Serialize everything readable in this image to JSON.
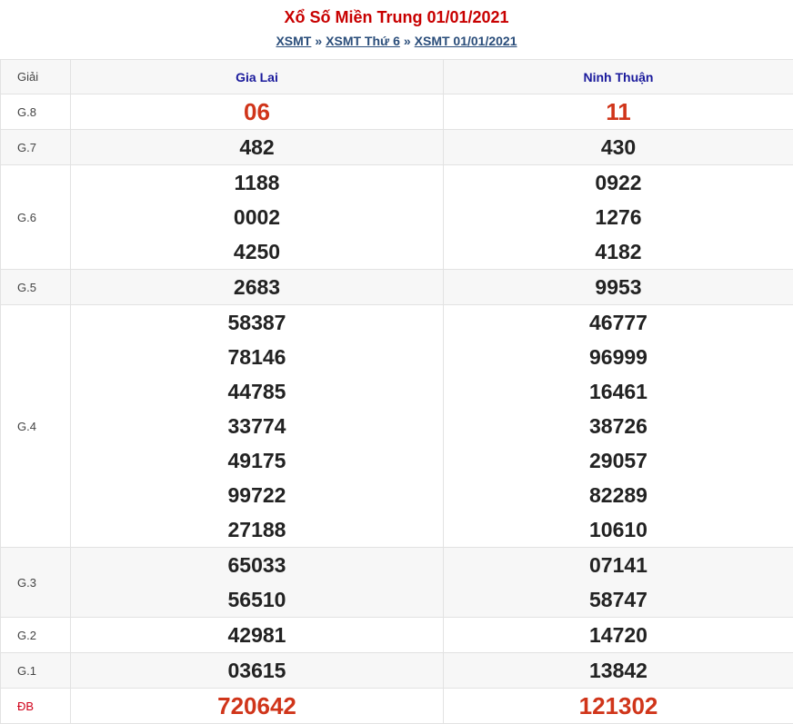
{
  "header": {
    "title": "Xổ Số Miền Trung 01/01/2021",
    "breadcrumb": [
      {
        "label": "XSMT"
      },
      {
        "label": "XSMT Thứ 6"
      },
      {
        "label": "XSMT 01/01/2021"
      }
    ],
    "separator": "»"
  },
  "table": {
    "col_prize": "Giải",
    "col1": "Gia Lai",
    "col2": "Ninh Thuận",
    "rows": [
      {
        "prize": "G.8",
        "gia_lai": [
          "06"
        ],
        "ninh_thuan": [
          "11"
        ]
      },
      {
        "prize": "G.7",
        "gia_lai": [
          "482"
        ],
        "ninh_thuan": [
          "430"
        ]
      },
      {
        "prize": "G.6",
        "gia_lai": [
          "1188",
          "0002",
          "4250"
        ],
        "ninh_thuan": [
          "0922",
          "1276",
          "4182"
        ]
      },
      {
        "prize": "G.5",
        "gia_lai": [
          "2683"
        ],
        "ninh_thuan": [
          "9953"
        ]
      },
      {
        "prize": "G.4",
        "gia_lai": [
          "58387",
          "78146",
          "44785",
          "33774",
          "49175",
          "99722",
          "27188"
        ],
        "ninh_thuan": [
          "46777",
          "96999",
          "16461",
          "38726",
          "29057",
          "82289",
          "10610"
        ]
      },
      {
        "prize": "G.3",
        "gia_lai": [
          "65033",
          "56510"
        ],
        "ninh_thuan": [
          "07141",
          "58747"
        ]
      },
      {
        "prize": "G.2",
        "gia_lai": [
          "42981"
        ],
        "ninh_thuan": [
          "14720"
        ]
      },
      {
        "prize": "G.1",
        "gia_lai": [
          "03615"
        ],
        "ninh_thuan": [
          "13842"
        ]
      },
      {
        "prize": "ĐB",
        "gia_lai": [
          "720642"
        ],
        "ninh_thuan": [
          "121302"
        ]
      }
    ]
  },
  "colors": {
    "title": "#c80000",
    "highlight_number": "#d0351a",
    "header_text": "#1a1a9c",
    "link": "#2a4d7a"
  }
}
